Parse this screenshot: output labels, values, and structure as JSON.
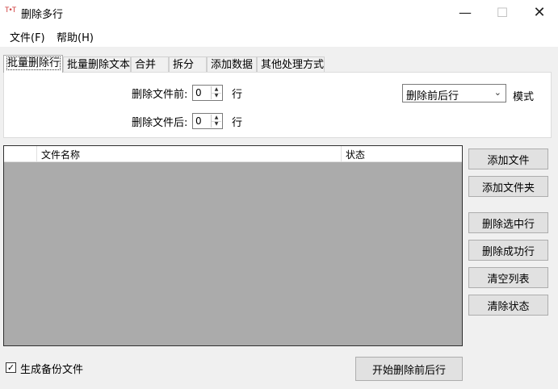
{
  "window": {
    "icon_text": "T•T",
    "title": "删除多行",
    "minimize_glyph": "—",
    "maximize_glyph": "☐",
    "close_glyph": "✕"
  },
  "menu": {
    "items": [
      {
        "label": "文件(F)"
      },
      {
        "label": "帮助(H)"
      }
    ]
  },
  "tabs": [
    {
      "label": "批量删除行",
      "active": true
    },
    {
      "label": "批量删除文本"
    },
    {
      "label": "合并"
    },
    {
      "label": "拆分"
    },
    {
      "label": "添加数据"
    },
    {
      "label": "其他处理方式"
    }
  ],
  "panel": {
    "before_label": "删除文件前:",
    "before_value": "0",
    "before_unit": "行",
    "after_label": "删除文件后:",
    "after_value": "0",
    "after_unit": "行",
    "mode_selected": "删除前后行",
    "mode_label": "模式",
    "spin_up": "▲",
    "spin_down": "▼",
    "chevron": "⌄"
  },
  "table": {
    "columns": [
      "",
      "文件名称",
      "状态"
    ],
    "rows": []
  },
  "buttons": {
    "add_file": "添加文件",
    "add_folder": "添加文件夹",
    "delete_selected": "删除选中行",
    "delete_success": "删除成功行",
    "clear_list": "清空列表",
    "clear_status": "清除状态",
    "start": "开始删除前后行"
  },
  "options": {
    "backup_label": "生成备份文件",
    "backup_checked": true,
    "check_glyph": "✓"
  }
}
